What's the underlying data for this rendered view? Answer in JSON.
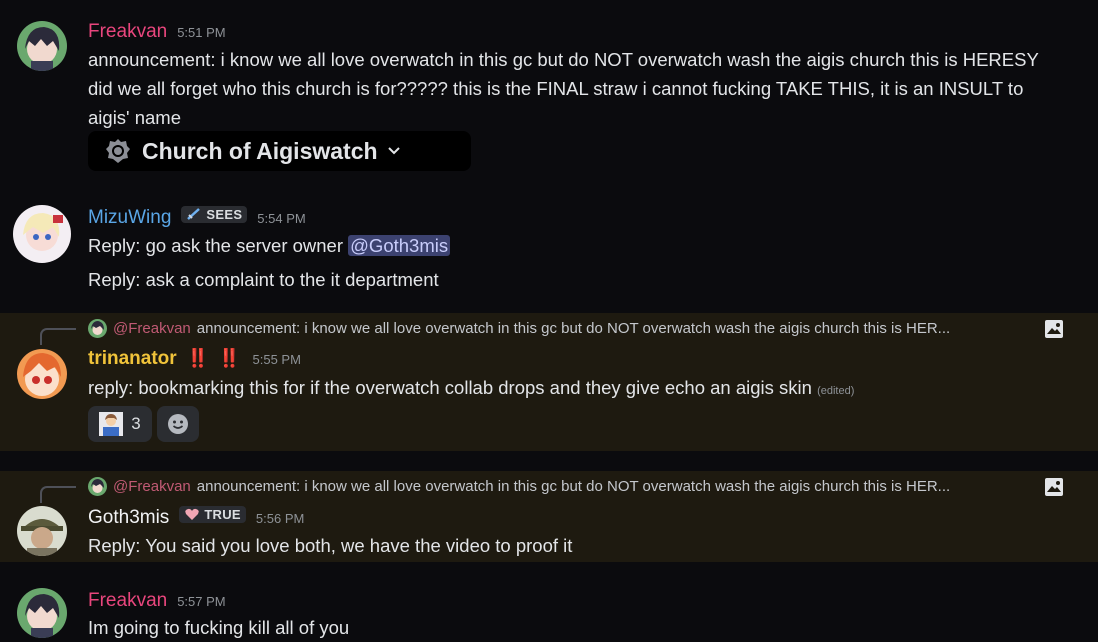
{
  "messages": [
    {
      "author": "Freakvan",
      "time": "5:51 PM",
      "lines": [
        "announcement: i know we all love overwatch in this gc but do NOT overwatch wash the aigis church this is HERESY",
        "did we all forget who this church is for????? this is the FINAL straw i cannot fucking TAKE THIS, it is an INSULT to",
        "aigis' name"
      ],
      "channel": "Church of Aigiswatch"
    },
    {
      "author": "MizuWing",
      "badge": "SEES",
      "time": "5:54 PM",
      "line1_prefix": "Reply: go ask the server owner ",
      "mention": "@Goth3mis",
      "line2": "Reply: ask a complaint to the it department"
    },
    {
      "reply_to": "@Freakvan",
      "reply_preview": "announcement: i know we all love overwatch in this gc but do NOT overwatch wash the aigis church this is HER...",
      "author": "trinanator",
      "exclaim": "‼️ ‼️",
      "time": "5:55 PM",
      "text": "reply: bookmarking this for if the overwatch collab drops and they give echo an aigis skin",
      "edited": "(edited)",
      "reaction_count": "3"
    },
    {
      "reply_to": "@Freakvan",
      "reply_preview": "announcement: i know we all love overwatch in this gc but do NOT overwatch wash the aigis church this is HER...",
      "author": "Goth3mis",
      "badge": "TRUE",
      "time": "5:56 PM",
      "text": "Reply: You said you love both, we have the video to proof it"
    },
    {
      "author": "Freakvan",
      "time": "5:57 PM",
      "text": "Im going to fucking kill all of you"
    }
  ],
  "colors": {
    "freakvan": "#e9467d",
    "mizuwing": "#5aa6e6",
    "trinanator": "#f0c33a",
    "goth3mis": "#f2f3f5"
  }
}
